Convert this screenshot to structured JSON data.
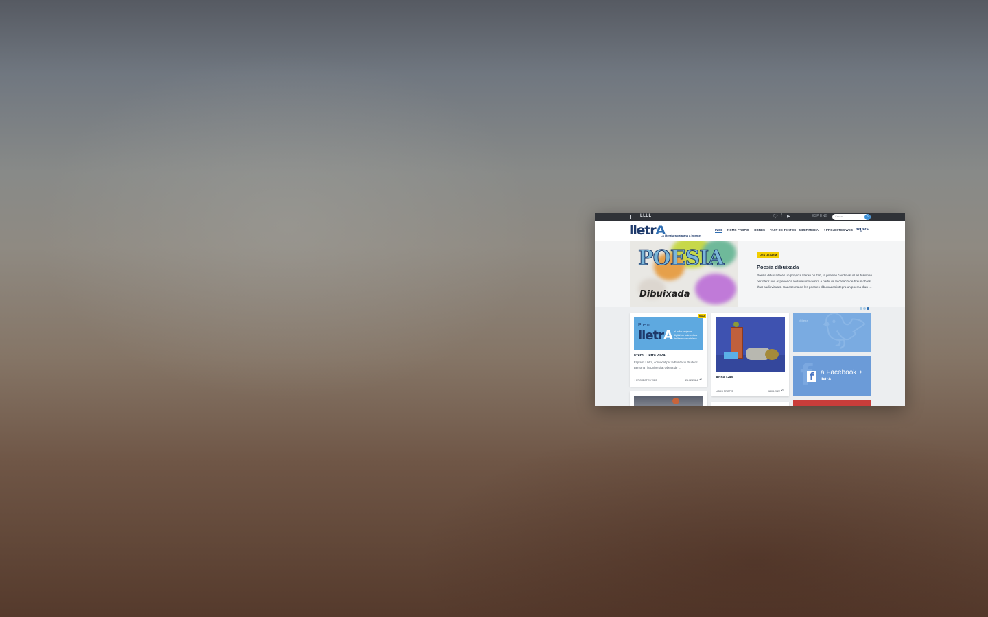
{
  "site": {
    "logo_small": "LLLL",
    "brand_main": "lletr",
    "brand_accent": "A",
    "tagline": "La literatura catalana a Internet",
    "languages": [
      "ESP",
      "ENG"
    ],
    "search_placeholder": "Cercar..."
  },
  "social_icons": [
    "twitter-icon",
    "facebook-icon",
    "youtube-icon"
  ],
  "nav": {
    "items": [
      "INICI",
      "NOMS PROPIS",
      "OBRES",
      "TAST DE TEXTOS",
      "MULTIMÈDIA",
      "+ PROJECTES WEB"
    ],
    "active": "INICI",
    "partner": "argus"
  },
  "hero": {
    "badge": "DESTAQUEM",
    "image_title": "POESIA",
    "image_subtitle": "Dibuixada",
    "title": "Poesia dibuixada",
    "text": "Poesia dibuixada és un projecte literari on l'art, la poesia i l'audiovisual es fusionen per oferir una experiència lectora innovadora a partir de la creació de breus obres d'art audiovisuals. Cadascuna de les poesies dibuixades integra un poema d'un …",
    "slides_total": 3,
    "slide_active": 3
  },
  "cards": [
    {
      "badge": "NOU",
      "promo_premi": "Premi",
      "promo_brand": "lletr",
      "promo_accent": "A",
      "promo_lines": [
        "al millor projecte",
        "digital per a la lectura",
        "de literatura catalana"
      ],
      "title": "Premi Lletra 2024",
      "text": "El premi Lletra, convocat per la Fundació Prudenci Bertrana i la Universitat Oberta de …",
      "category": "+ PROJECTES WEB",
      "date": "26.02.2024"
    },
    {
      "title": "Anna Gas",
      "category": "NOMS PROPIS",
      "date": "08.03.2022"
    }
  ],
  "widgets": {
    "twitter_label": "@lletra",
    "facebook_text": "a Facebook",
    "facebook_sub": "lletrA"
  },
  "colors": {
    "topbar": "#2f3237",
    "brand": "#1e3a6b",
    "accent": "#2f6fb3",
    "badge": "#f2cd00",
    "twitter": "#7aabe1",
    "facebook": "#6b9bd8"
  }
}
